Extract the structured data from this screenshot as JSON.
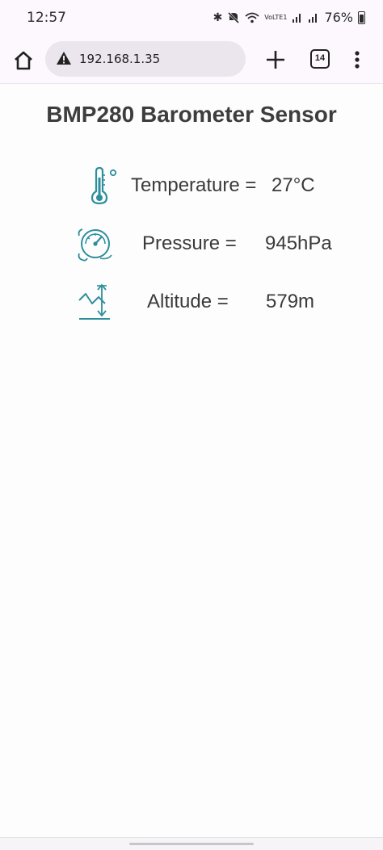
{
  "status_bar": {
    "time": "12:57",
    "network_label": "VoLTE1",
    "battery_text": "76%",
    "battery_level": 0.76,
    "icons": [
      "bluetooth-icon",
      "mute-icon",
      "wifi-icon",
      "volte-icon",
      "signal-icon",
      "signal-icon",
      "battery-icon"
    ]
  },
  "toolbar": {
    "url": "192.168.1.35",
    "tab_count": "14",
    "icons": [
      "home-icon",
      "warning-icon",
      "plus-icon",
      "tabs-icon",
      "more-vert-icon"
    ]
  },
  "page": {
    "title": "BMP280 Barometer Sensor",
    "readings": [
      {
        "icon": "thermometer-icon",
        "label": "Temperature =",
        "value": "27°C"
      },
      {
        "icon": "gauge-icon",
        "label": "Pressure =",
        "value": "945hPa"
      },
      {
        "icon": "altitude-icon",
        "label": "Altitude =",
        "value": "579m"
      }
    ],
    "accent_color": "#2e8f9a"
  }
}
